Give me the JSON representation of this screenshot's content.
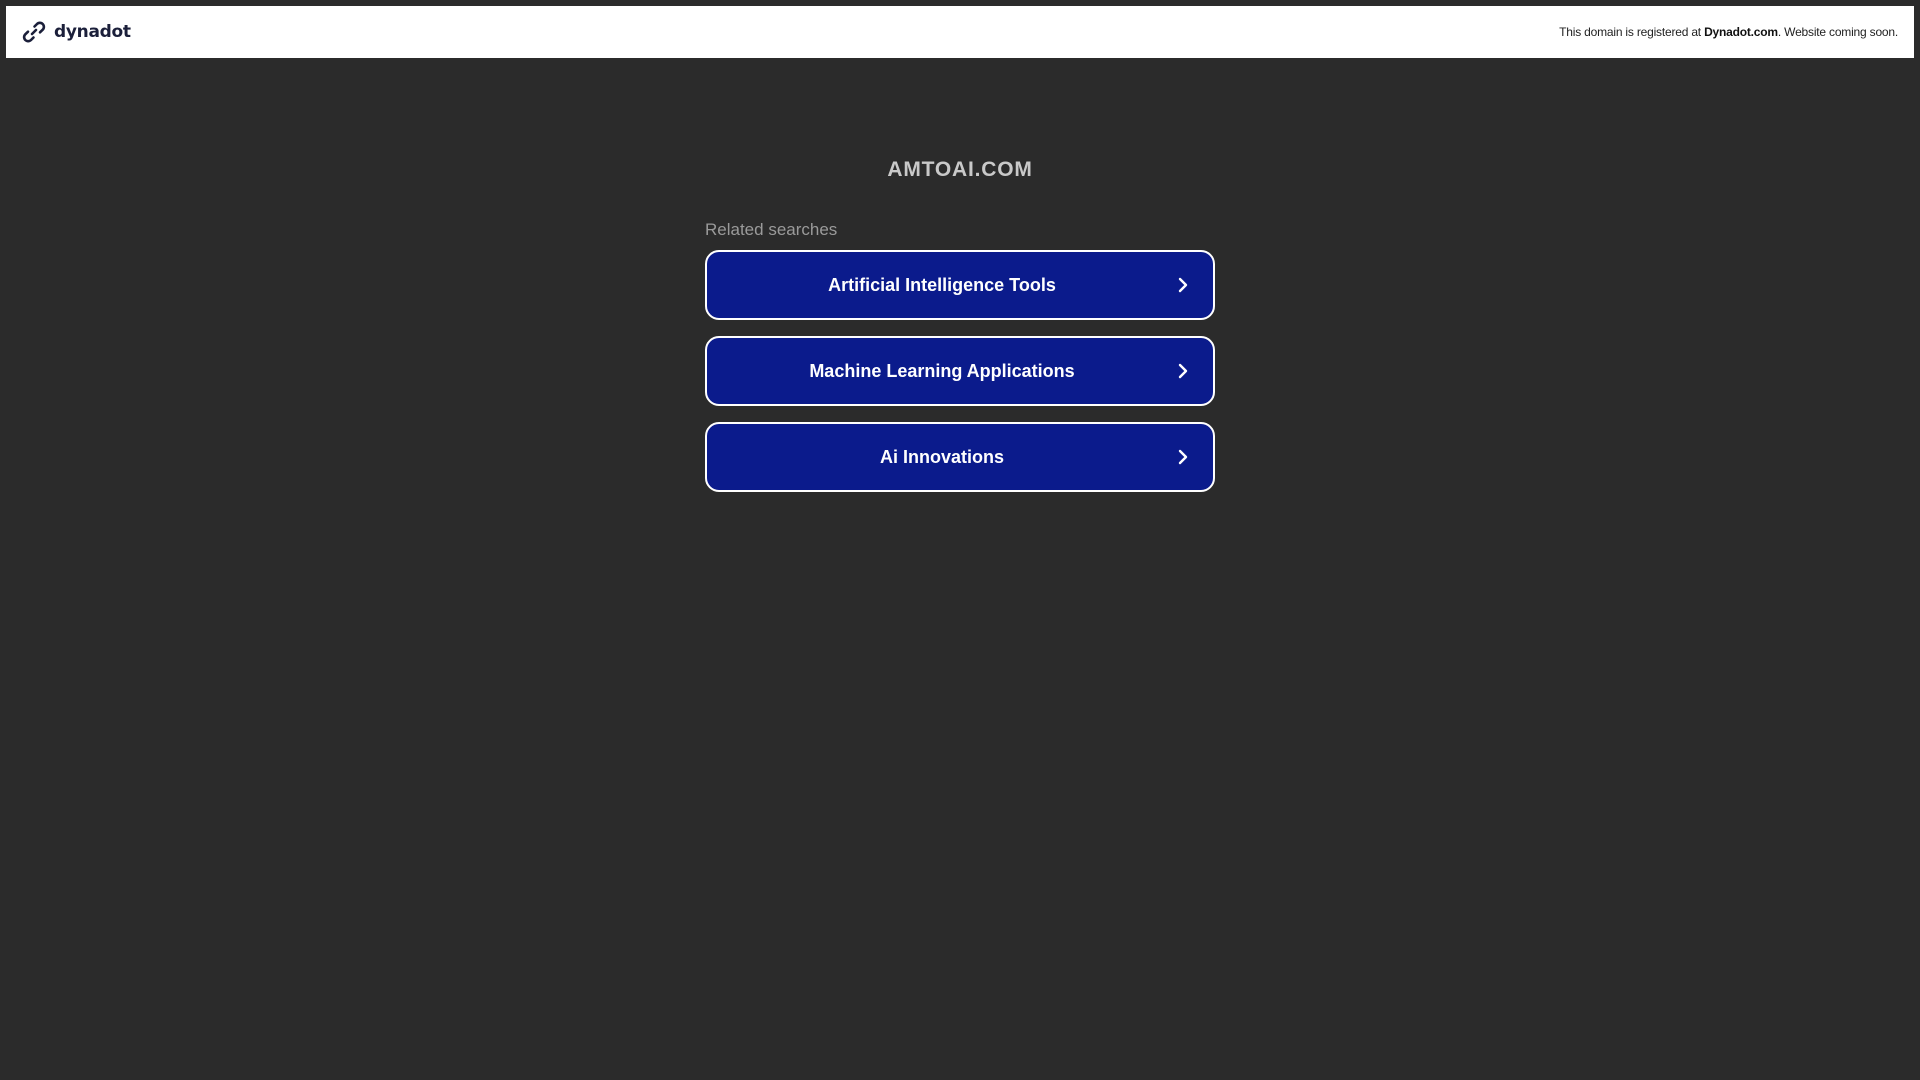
{
  "topbar": {
    "brand_name": "dynadot",
    "logo_icon": "dynadot-link-logo",
    "notice_prefix": "This domain is registered at ",
    "notice_link": "Dynadot.com",
    "notice_suffix": ". Website coming soon."
  },
  "main": {
    "domain": "AMTOAI.COM",
    "related_heading": "Related searches",
    "searches": [
      {
        "label": "Artificial Intelligence Tools",
        "icon": "chevron-right-icon"
      },
      {
        "label": "Machine Learning Applications",
        "icon": "chevron-right-icon"
      },
      {
        "label": "Ai Innovations",
        "icon": "chevron-right-icon"
      }
    ]
  },
  "colors": {
    "background": "#2b2b2b",
    "button": "#0b1b8c",
    "button_border": "#ffffff",
    "title": "#c9c9c9"
  }
}
